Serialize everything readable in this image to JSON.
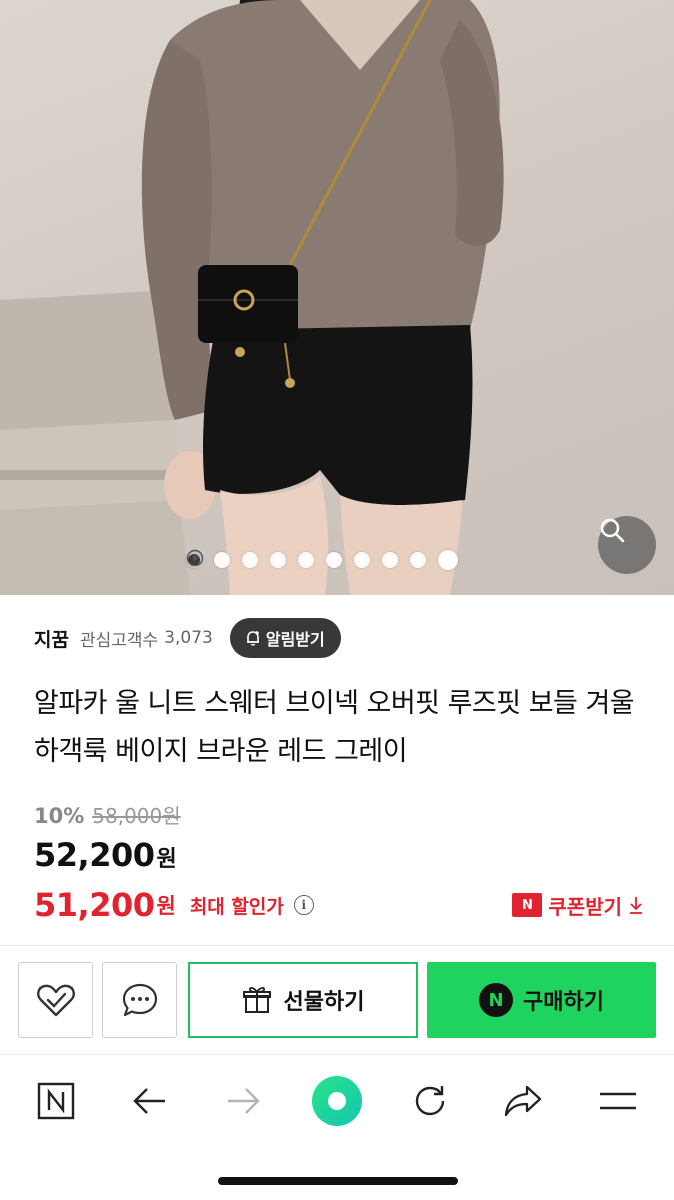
{
  "gallery": {
    "total_images": 10,
    "current_image": 1,
    "zoom_icon": "magnifier-icon",
    "video_icon": "play-icon"
  },
  "store": {
    "name": "지꿈",
    "fans_label": "관심고객수",
    "fans_count": "3,073",
    "alarm_label": "알림받기",
    "alarm_icon": "bell-plus-icon"
  },
  "product": {
    "title": "알파카 울 니트 스웨터 브이넥 오버핏 루즈핏 보들 겨울 하객룩 베이지 브라운 레드 그레이"
  },
  "price": {
    "discount_rate": "10%",
    "original": "58,000원",
    "sale_amount": "52,200",
    "sale_unit": "원",
    "best_amount": "51,200",
    "best_unit": "원",
    "best_label": "최대 할인가",
    "info_icon": "info-icon",
    "coupon_badge": "N",
    "coupon_label": "쿠폰받기",
    "coupon_icon": "download-arrow-icon",
    "accent_color": "#e0232e"
  },
  "actions": {
    "wish_icon": "heart-check-icon",
    "talk_icon": "chat-bubble-icon",
    "gift_label": "선물하기",
    "gift_icon": "gift-box-icon",
    "buy_badge": "N",
    "buy_label": "구매하기",
    "buy_color": "#1fd45e"
  },
  "browser_toolbar": {
    "items": [
      "naver-home-icon",
      "back-arrow-icon",
      "forward-arrow-icon",
      "green-dot-icon",
      "refresh-icon",
      "share-icon",
      "menu-icon"
    ]
  }
}
